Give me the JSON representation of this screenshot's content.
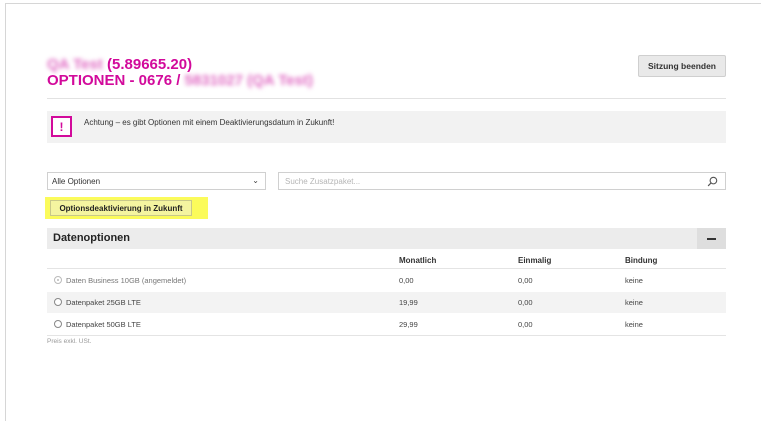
{
  "header": {
    "title_line1_prefix_redacted": "QA Test",
    "title_line1_suffix": "(5.89665.20)",
    "title_line2_prefix": "OPTIONEN - 0676 /",
    "title_line2_suffix_redacted": "5831027 (QA Test)",
    "end_session_label": "Sitzung beenden"
  },
  "alert": {
    "icon_glyph": "!",
    "text": "Achtung – es gibt Optionen mit einem Deaktivierungsdatum in Zukunft!"
  },
  "filter": {
    "selected_option": "Alle Optionen",
    "search_placeholder": "Suche Zusatzpaket..."
  },
  "actions": {
    "deactivation_future_label": "Optionsdeaktivierung in Zukunft"
  },
  "section": {
    "title": "Datenoptionen",
    "columns": [
      "Monatlich",
      "Einmalig",
      "Bindung"
    ],
    "rows": [
      {
        "label": "Daten Business 10GB (angemeldet)",
        "monthly": "0,00",
        "once": "0,00",
        "binding": "keine",
        "selected": true
      },
      {
        "label": "Datenpaket 25GB LTE",
        "monthly": "19,99",
        "once": "0,00",
        "binding": "keine",
        "selected": false
      },
      {
        "label": "Datenpaket 50GB LTE",
        "monthly": "29,99",
        "once": "0,00",
        "binding": "keine",
        "selected": false
      }
    ]
  },
  "footnote": "Preis exkl. USt.",
  "colors": {
    "brand_magenta": "#d20a9b",
    "highlight_yellow": "#fbfb5b"
  }
}
